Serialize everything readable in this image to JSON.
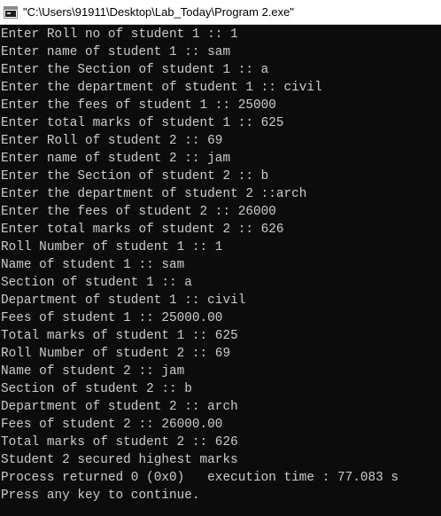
{
  "window": {
    "title": "\"C:\\Users\\91911\\Desktop\\Lab_Today\\Program 2.exe\"",
    "colors": {
      "background": "#0c0c0c",
      "text": "#cccccc",
      "titlebar": "#ffffff"
    }
  },
  "console": {
    "lines": [
      "Enter Roll no of student 1 :: 1",
      "Enter name of student 1 :: sam",
      "Enter the Section of student 1 :: a",
      "Enter the department of student 1 :: civil",
      "Enter the fees of student 1 :: 25000",
      "Enter total marks of student 1 :: 625",
      "Enter Roll of student 2 :: 69",
      "Enter name of student 2 :: jam",
      "Enter the Section of student 2 :: b",
      "Enter the department of student 2 ::arch",
      "Enter the fees of student 2 :: 26000",
      "Enter total marks of student 2 :: 626",
      "Roll Number of student 1 :: 1",
      "Name of student 1 :: sam",
      "Section of student 1 :: a",
      "Department of student 1 :: civil",
      "Fees of student 1 :: 25000.00",
      "Total marks of student 1 :: 625",
      "Roll Number of student 2 :: 69",
      "Name of student 2 :: jam",
      "Section of student 2 :: b",
      "Department of student 2 :: arch",
      "Fees of student 2 :: 26000.00",
      "Total marks of student 2 :: 626",
      "Student 2 secured highest marks",
      "Process returned 0 (0x0)   execution time : 77.083 s",
      "Press any key to continue."
    ]
  }
}
